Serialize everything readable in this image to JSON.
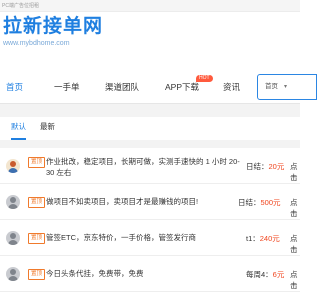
{
  "topbar": {
    "text": "PC端广告位招租"
  },
  "brand": {
    "title": "拉新接单网",
    "url": "www.mybdhome.com"
  },
  "nav": {
    "items": [
      "首页",
      "一手单",
      "渠道团队",
      "APP下载",
      "资讯"
    ],
    "hot_badge": "HOT",
    "search_select": "首页"
  },
  "tabs": [
    "默认",
    "最新"
  ],
  "rows": [
    {
      "badge": "置顶",
      "title": "作业批改，稳定项目，长期可做，实测手速快的 1 小时 20-30 左右",
      "price_label": "日结：",
      "price_value": "20元",
      "action": "点击"
    },
    {
      "badge": "置顶",
      "title": "做项目不如卖项目，卖项目才是最赚钱的项目!",
      "price_label": "日结：",
      "price_value": "500元",
      "action": "点击"
    },
    {
      "badge": "置顶",
      "title": "管签ETC，京东特价，一手价格，管签发行商",
      "price_label": "t1：",
      "price_value": "240元",
      "action": "点击"
    },
    {
      "badge": "置顶",
      "title": "今日头条代挂，免费带，免费",
      "price_label": "每周4：",
      "price_value": "6元",
      "action": "点击"
    }
  ],
  "colors": {
    "accent": "#1f7fe0",
    "price": "#f0451e",
    "badge": "#f07a2c",
    "hot": "#ff5a3d"
  }
}
